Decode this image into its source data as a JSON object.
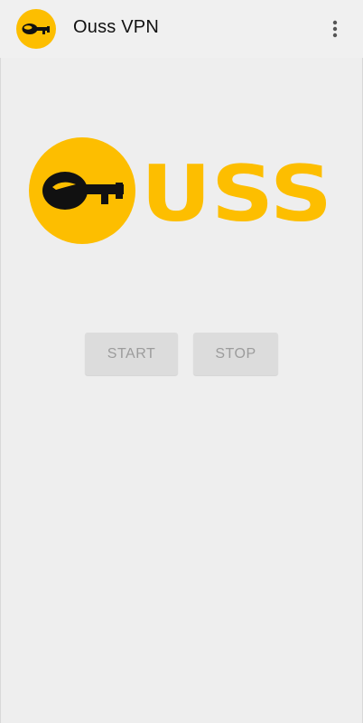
{
  "app_bar": {
    "title": "Ouss VPN",
    "app_icon": "key-logo-icon",
    "menu_icon": "more-vert-icon"
  },
  "logo": {
    "wordmark": "USS",
    "brand_color": "#fdbe00",
    "key_color": "#111111"
  },
  "controls": {
    "start_label": "START",
    "stop_label": "STOP"
  },
  "colors": {
    "background": "#eeeeee",
    "button_bg": "#dcdcdc",
    "button_text": "#9c9c9c"
  }
}
